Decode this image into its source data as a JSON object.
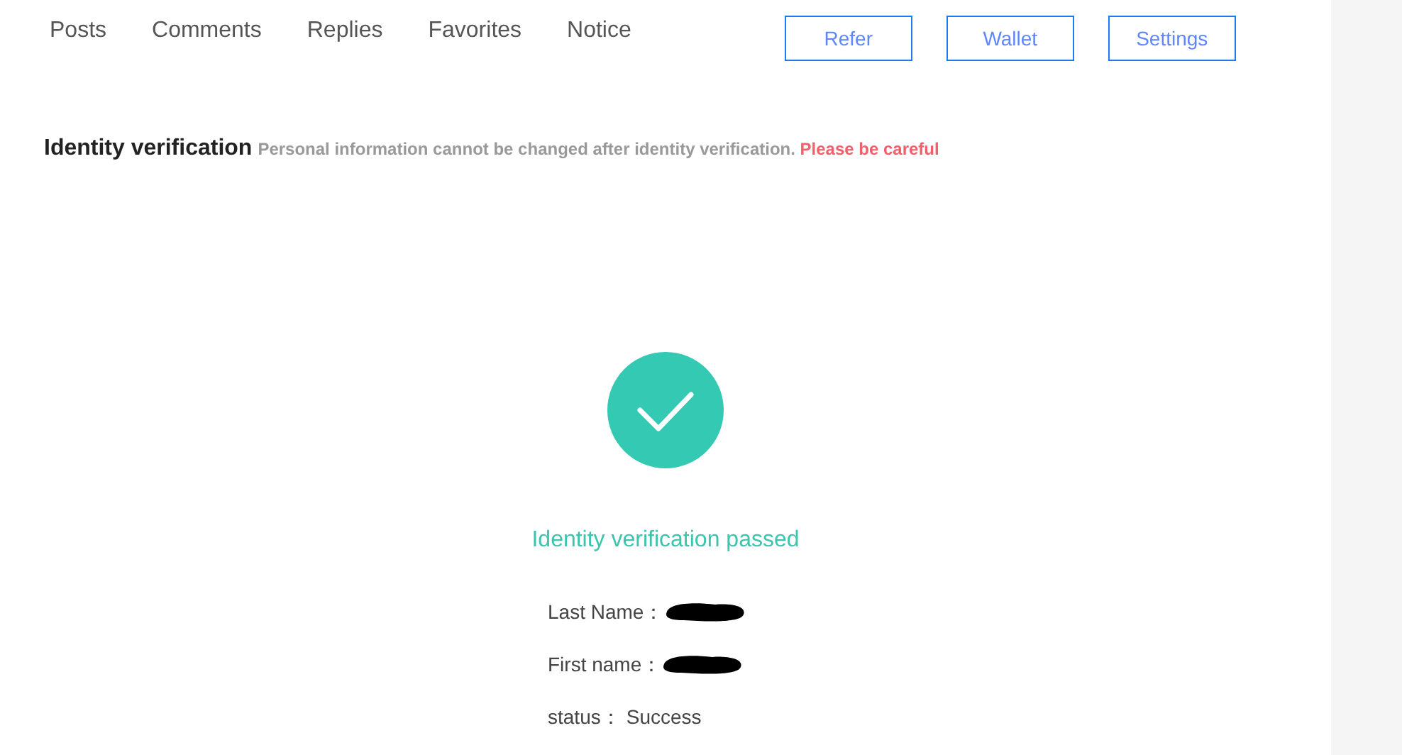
{
  "tabs": [
    {
      "label": "Posts"
    },
    {
      "label": "Comments"
    },
    {
      "label": "Replies"
    },
    {
      "label": "Favorites"
    },
    {
      "label": "Notice"
    }
  ],
  "buttons": [
    "Refer",
    "Wallet",
    "Settings"
  ],
  "section": {
    "title": "Identity verification",
    "note": "Personal information cannot be changed after identity verification.",
    "warning": "Please be careful"
  },
  "result": {
    "message": "Identity verification passed"
  },
  "fields": [
    {
      "label": "Last Name：",
      "kind": "redacted"
    },
    {
      "label": "First name：",
      "kind": "redacted"
    },
    {
      "label": "status：",
      "kind": "text",
      "value": "Success"
    }
  ]
}
